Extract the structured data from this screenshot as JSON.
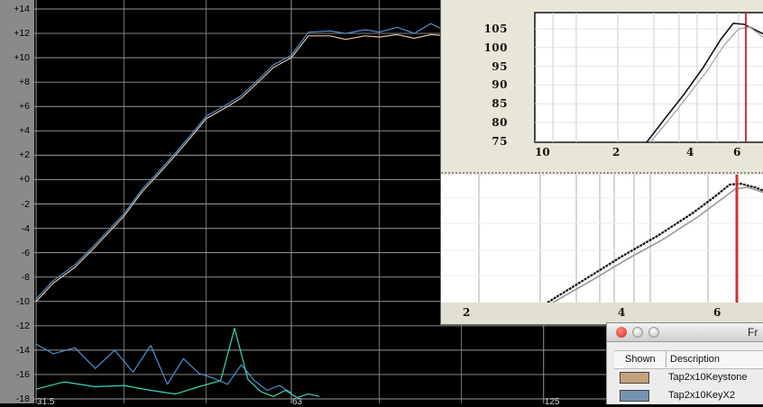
{
  "main_chart": {
    "y_ticks": [
      "+14",
      "+12",
      "+10",
      "+8",
      "+6",
      "+4",
      "+2",
      "+0",
      "-2",
      "-4",
      "-6",
      "-8",
      "-10",
      "-12",
      "-14",
      "-16",
      "-18"
    ],
    "x_ticks": [
      "31.5",
      "63",
      "125"
    ],
    "colors": {
      "background": "#000000",
      "grid": "#9a9a9a",
      "series_tan": "#e2c4a6",
      "series_blue": "#4f8fd0",
      "series_green": "#3fd6b8"
    }
  },
  "inset_top": {
    "y_ticks": [
      "105",
      "100",
      "95",
      "90",
      "85",
      "80",
      "75"
    ],
    "x_ticks": [
      "10",
      "2",
      "4",
      "6"
    ]
  },
  "inset_bottom": {
    "x_ticks": [
      "2",
      "4",
      "6"
    ]
  },
  "legend_window": {
    "title": "Fr",
    "columns": {
      "shown": "Shown",
      "description": "Description"
    },
    "rows": [
      {
        "name": "Tap2x10Keystone",
        "color": "#c4a27c"
      },
      {
        "name": "Tap2x10KeyX2",
        "color": "#7792b0"
      }
    ]
  },
  "chart_data": {
    "type": "line",
    "xlabel": "",
    "ylabel": "",
    "x_ticks": [
      "31.5",
      "63",
      "125"
    ],
    "ylim": [
      -18,
      14
    ],
    "grid": true,
    "series": [
      {
        "color": "#e2c4a6",
        "x": [
          31.5,
          33,
          35,
          37,
          40,
          42,
          44,
          46,
          48,
          50,
          53,
          55,
          58,
          60,
          63,
          66,
          70,
          73,
          77,
          80,
          84,
          88,
          92,
          96,
          100,
          105,
          110,
          115,
          120,
          125,
          130
        ],
        "values": [
          -10,
          -8.5,
          -7.2,
          -5.5,
          -3,
          -1,
          0.5,
          2,
          3.5,
          5,
          6,
          6.7,
          8.2,
          9.2,
          10,
          11.8,
          11.8,
          11.5,
          11.8,
          11.7,
          11.9,
          11.6,
          11.9,
          11.8,
          11.5,
          11.9,
          11.0,
          11.8,
          12.1,
          11.8,
          11.7
        ]
      },
      {
        "color": "#4f8fd0",
        "x": [
          31.5,
          33,
          35,
          37,
          40,
          42,
          44,
          46,
          48,
          50,
          53,
          55,
          58,
          60,
          63,
          66,
          70,
          73,
          77,
          80,
          84,
          88,
          92,
          96,
          100,
          105,
          110,
          115,
          120,
          125,
          130
        ],
        "values": [
          -9.8,
          -8.3,
          -7.0,
          -5.3,
          -2.8,
          -0.8,
          0.7,
          2.2,
          3.7,
          5.2,
          6.2,
          6.9,
          8.4,
          9.4,
          10.2,
          12.1,
          12.2,
          12.0,
          12.3,
          12.1,
          12.5,
          12.0,
          12.8,
          12.2,
          11.9,
          12.6,
          11.4,
          12.3,
          12.6,
          12.0,
          12.0
        ]
      },
      {
        "color": "#4f8fd0",
        "x": [
          31.5,
          33,
          35,
          37,
          39,
          41,
          43,
          45,
          47,
          49,
          51,
          53,
          55,
          57,
          59,
          61,
          63
        ],
        "values": [
          -13.5,
          -14.3,
          -13.8,
          -15.5,
          -14.0,
          -15.8,
          -13.6,
          -16.8,
          -14.7,
          -15.9,
          -16.3,
          -16.8,
          -15.2,
          -16.5,
          -17.3,
          -16.9,
          -17.5
        ]
      },
      {
        "color": "#3fd6b8",
        "x": [
          31.5,
          34,
          37,
          40,
          43,
          46,
          49,
          52,
          54,
          56,
          58,
          60,
          62,
          64,
          66,
          68
        ],
        "values": [
          -17.2,
          -16.6,
          -17.0,
          -16.9,
          -17.3,
          -17.6,
          -17.0,
          -16.5,
          -12.2,
          -16.4,
          -17.4,
          -17.8,
          -17.3,
          -17.9,
          -17.6,
          -17.8
        ]
      }
    ]
  }
}
